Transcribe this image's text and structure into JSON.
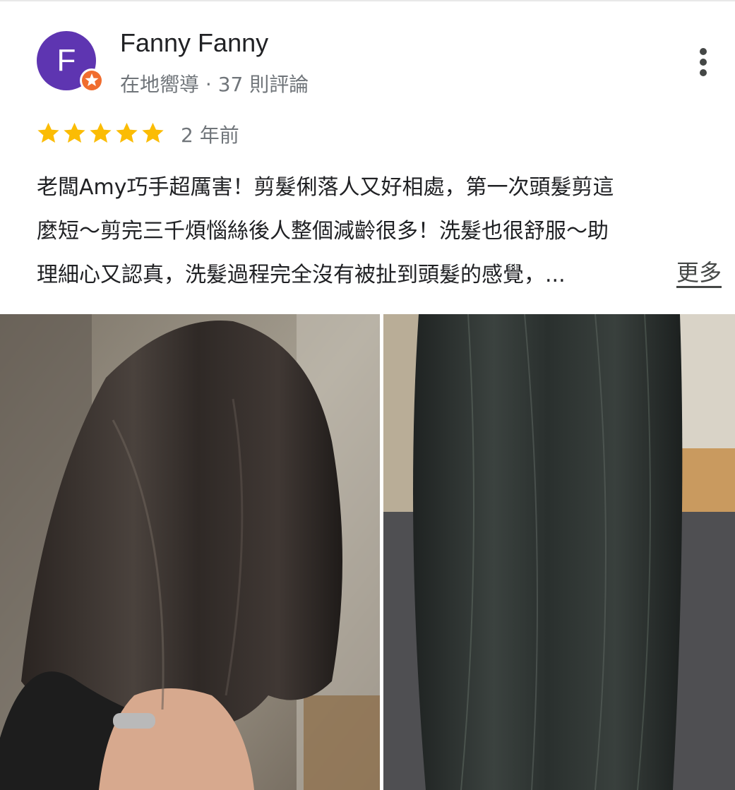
{
  "reviewer": {
    "avatar_letter": "F",
    "avatar_color": "#5e35b1",
    "badge_color": "#f06d2f",
    "name": "Fanny Fanny",
    "meta": "在地嚮導 · 37 則評論"
  },
  "review": {
    "rating": 5,
    "star_color": "#fbbc04",
    "time": "2 年前",
    "lines": [
      "老闆Amy巧手超厲害！剪髮俐落人又好相處，第一次頭髮剪這",
      "麼短～剪完三千煩惱絲後人整個減齡很多！洗髮也很舒服～助",
      "理細心又認真，洗髮過程完全沒有被扯到頭髮的感覺，..."
    ],
    "more_label": "更多"
  },
  "photos": [
    {
      "name": "short-haircut-photo"
    },
    {
      "name": "long-wet-hair-photo"
    }
  ],
  "icons": {
    "menu": "more-vert-icon",
    "badge": "local-guide-star-icon",
    "star": "star-icon"
  }
}
